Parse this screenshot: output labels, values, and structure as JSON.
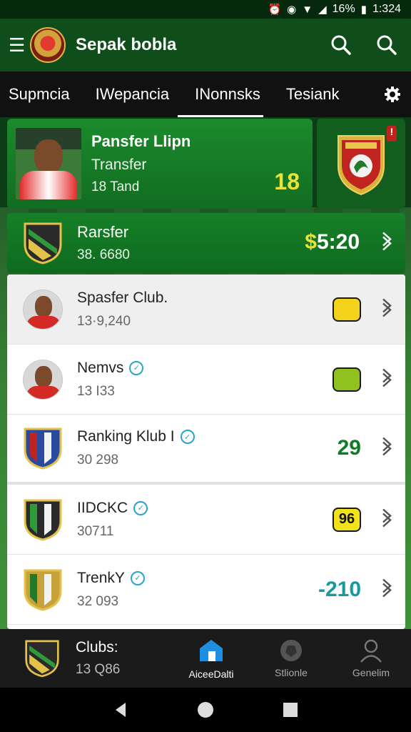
{
  "status_bar": {
    "battery": "16%",
    "time": "1:324"
  },
  "app_bar": {
    "title": "Sepak bobla"
  },
  "tabs": [
    {
      "label": "Supmcia"
    },
    {
      "label": "IWepancia"
    },
    {
      "label": "INonnsks"
    },
    {
      "label": "Tesiank"
    }
  ],
  "featured": {
    "title": "Pansfer Llipn",
    "subtitle": "Transfer",
    "meta": "18 Tand",
    "value": "18"
  },
  "banner": {
    "title": "Rarsfer",
    "subtitle": "38. 6680",
    "value_prefix": "$",
    "value": "5:20"
  },
  "list": [
    {
      "title": "Spasfer Club.",
      "subtitle": "13·9,240",
      "right_type": "chip",
      "right_text": "",
      "chip_color": "#f2d21a",
      "verified": false,
      "media": "avatar"
    },
    {
      "title": "Nemvs",
      "subtitle": "13 I33",
      "right_type": "chip",
      "right_text": "",
      "chip_color": "#8fc21f",
      "verified": true,
      "media": "avatar"
    },
    {
      "title": "Ranking Klub I",
      "subtitle": "30 298",
      "right_type": "number",
      "right_text": "29",
      "number_color": "#137a2a",
      "verified": true,
      "media": "crest"
    },
    {
      "title": "IIDCKC",
      "subtitle": "30711",
      "right_type": "chip",
      "right_text": "96",
      "chip_color": "#f2e21a",
      "verified": true,
      "media": "crest"
    },
    {
      "title": "TrenkY",
      "subtitle": "32 093",
      "right_type": "number",
      "right_text": "-210",
      "number_color": "#179a9a",
      "verified": true,
      "media": "crest"
    }
  ],
  "bottom_nav": {
    "club_title": "Clubs:",
    "club_sub": "13 Q86",
    "items": [
      {
        "label": "AiceeDalti",
        "icon": "home-icon"
      },
      {
        "label": "Stlionle",
        "icon": "ball-icon"
      },
      {
        "label": "Genelim",
        "icon": "profile-icon"
      }
    ]
  },
  "colors": {
    "app_bar": "#0f4d1a",
    "card_green": "#168028",
    "accent_yellow": "#e8e23a",
    "nav_active": "#1e8fe0"
  }
}
